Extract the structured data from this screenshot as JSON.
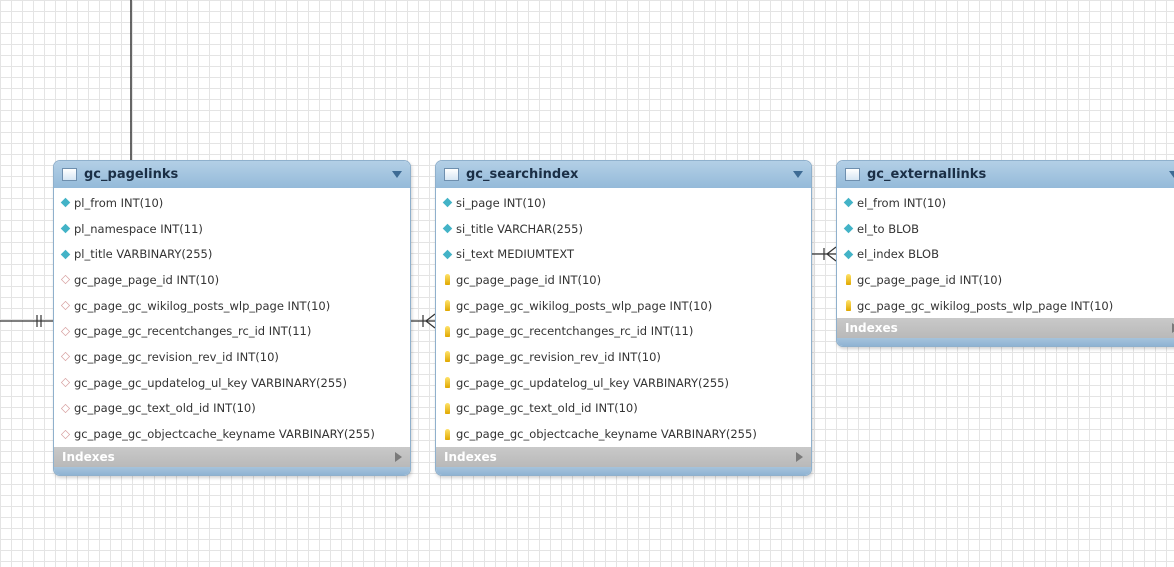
{
  "diagram": {
    "entities": [
      {
        "title": "gc_pagelinks",
        "columns": [
          {
            "text": "pl_from INT(10)",
            "kind": "column"
          },
          {
            "text": "pl_namespace INT(11)",
            "kind": "column"
          },
          {
            "text": "pl_title VARBINARY(255)",
            "kind": "column"
          },
          {
            "text": "gc_page_page_id INT(10)",
            "kind": "fk"
          },
          {
            "text": "gc_page_gc_wikilog_posts_wlp_page INT(10)",
            "kind": "fk"
          },
          {
            "text": "gc_page_gc_recentchanges_rc_id INT(11)",
            "kind": "fk"
          },
          {
            "text": "gc_page_gc_revision_rev_id INT(10)",
            "kind": "fk"
          },
          {
            "text": "gc_page_gc_updatelog_ul_key VARBINARY(255)",
            "kind": "fk"
          },
          {
            "text": "gc_page_gc_text_old_id INT(10)",
            "kind": "fk"
          },
          {
            "text": "gc_page_gc_objectcache_keyname VARBINARY(255)",
            "kind": "fk"
          }
        ],
        "indexes_label": "Indexes"
      },
      {
        "title": "gc_searchindex",
        "columns": [
          {
            "text": "si_page INT(10)",
            "kind": "column"
          },
          {
            "text": "si_title VARCHAR(255)",
            "kind": "column"
          },
          {
            "text": "si_text MEDIUMTEXT",
            "kind": "column"
          },
          {
            "text": "gc_page_page_id INT(10)",
            "kind": "key"
          },
          {
            "text": "gc_page_gc_wikilog_posts_wlp_page INT(10)",
            "kind": "key"
          },
          {
            "text": "gc_page_gc_recentchanges_rc_id INT(11)",
            "kind": "key"
          },
          {
            "text": "gc_page_gc_revision_rev_id INT(10)",
            "kind": "key"
          },
          {
            "text": "gc_page_gc_updatelog_ul_key VARBINARY(255)",
            "kind": "key"
          },
          {
            "text": "gc_page_gc_text_old_id INT(10)",
            "kind": "key"
          },
          {
            "text": "gc_page_gc_objectcache_keyname VARBINARY(255)",
            "kind": "key"
          }
        ],
        "indexes_label": "Indexes"
      },
      {
        "title": "gc_externallinks",
        "columns": [
          {
            "text": "el_from INT(10)",
            "kind": "column"
          },
          {
            "text": "el_to BLOB",
            "kind": "column"
          },
          {
            "text": "el_index BLOB",
            "kind": "column"
          },
          {
            "text": "gc_page_page_id INT(10)",
            "kind": "key"
          },
          {
            "text": "gc_page_gc_wikilog_posts_wlp_page INT(10)",
            "kind": "key"
          }
        ],
        "indexes_label": "Indexes"
      }
    ],
    "colors": {
      "header": "#94bad9",
      "column_icon": "#43b3c7",
      "fk_icon": "#d8a3a3",
      "key_icon": "#e0a800",
      "indexes_bar": "#c0c0c0",
      "connector": "#333333"
    }
  }
}
